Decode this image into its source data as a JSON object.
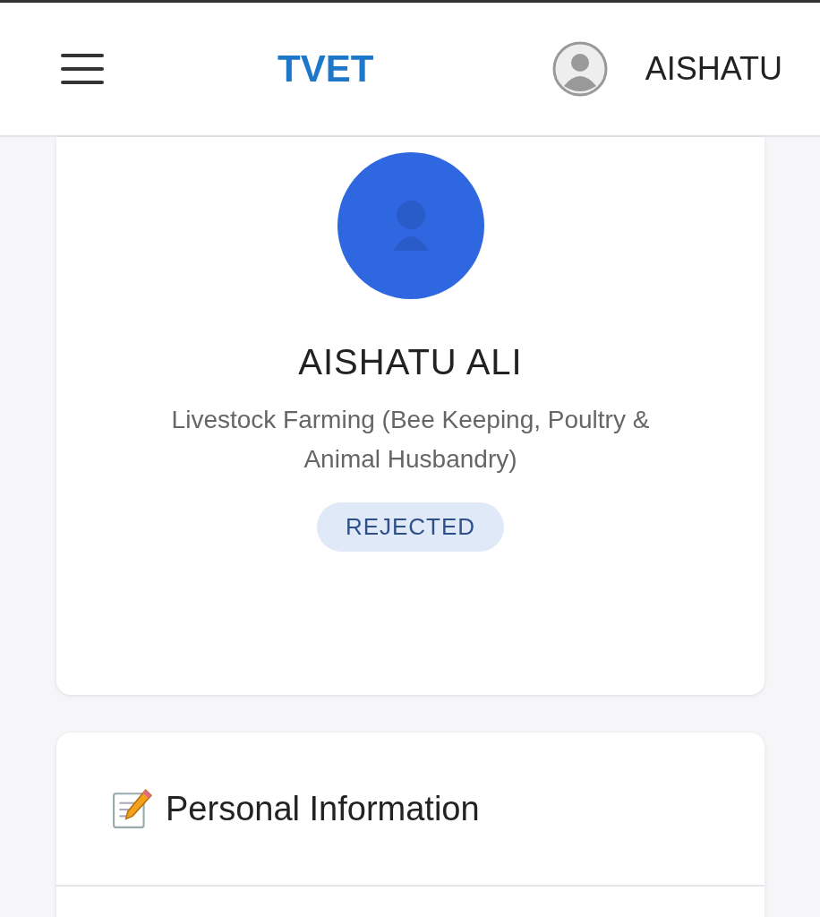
{
  "header": {
    "logo": "TVET",
    "user_name": "AISHATU"
  },
  "profile": {
    "name": "AISHATU ALI",
    "program": "Livestock Farming (Bee Keeping, Poultry & Animal Husbandry)",
    "status": {
      "label": "REJECTED",
      "kind": "rejected"
    }
  },
  "sections": [
    {
      "title": "Personal Information",
      "expanded": true
    }
  ]
}
